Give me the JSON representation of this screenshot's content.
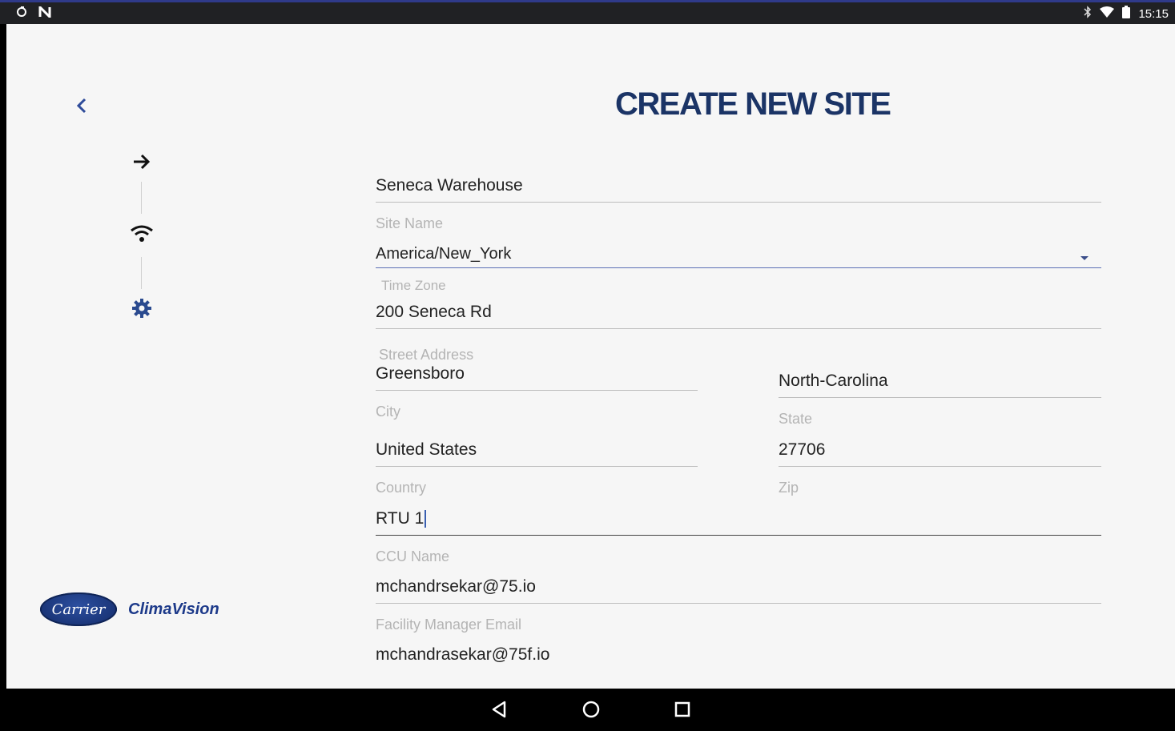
{
  "status_bar": {
    "left_icons": [
      "sync-icon",
      "nfc-icon"
    ],
    "right_icons": [
      "bluetooth-icon",
      "wifi-icon",
      "battery-icon"
    ],
    "time": "15:15"
  },
  "header": {
    "title": "CREATE NEW SITE"
  },
  "steps": [
    "arrow-right-icon",
    "wifi-icon",
    "gear-icon"
  ],
  "logo": {
    "carrier": "Carrier",
    "product": "ClimaVision"
  },
  "form": {
    "site_name": {
      "value": "Seneca Warehouse",
      "label": "Site Name"
    },
    "time_zone": {
      "value": "America/New_York",
      "label": "Time Zone"
    },
    "street_address": {
      "value": "200 Seneca Rd",
      "label": "Street Address"
    },
    "city": {
      "value": "Greensboro",
      "label": "City"
    },
    "state": {
      "value": "North-Carolina",
      "label": "State"
    },
    "country": {
      "value": "United States",
      "label": "Country"
    },
    "zip": {
      "value": "27706",
      "label": "Zip"
    },
    "ccu_name": {
      "value": "RTU 1",
      "label": "CCU Name"
    },
    "facility_manager_email": {
      "value": "mchandrsekar@75.io",
      "label": "Facility Manager Email"
    },
    "installer_email": {
      "value": "mchandrasekar@75f.io"
    }
  },
  "nav_bar": [
    "back-icon",
    "home-icon",
    "recents-icon"
  ],
  "colors": {
    "title": "#1b3466",
    "accent": "#1d3a8a",
    "background": "#f6f6f6"
  }
}
